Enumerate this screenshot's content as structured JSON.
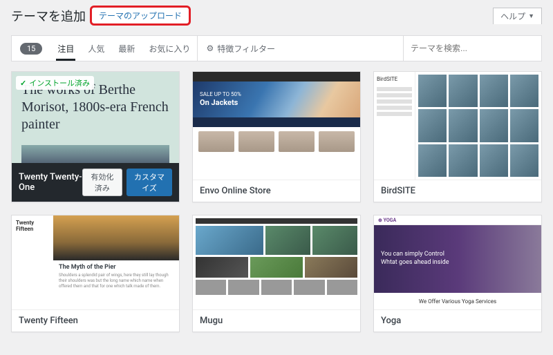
{
  "header": {
    "page_title": "テーマを追加",
    "upload_button": "テーマのアップロード",
    "help_tab": "ヘルプ"
  },
  "filter": {
    "count": "15",
    "tabs": {
      "featured": "注目",
      "popular": "人気",
      "latest": "最新",
      "favorite": "お気に入り"
    },
    "feature_filter": "特徴フィルター",
    "search_placeholder": "テーマを検索..."
  },
  "themes": {
    "twenty21": {
      "name": "Twenty Twenty-One",
      "installed_label": "インストール済み",
      "headline": "The works of Berthe Morisot, 1800s-era French painter",
      "activated_btn": "有効化済み",
      "customize_btn": "カスタマイズ"
    },
    "envo": {
      "name": "Envo Online Store",
      "hero_small": "SALE UP TO 50%",
      "hero_big": "On Jackets"
    },
    "birdsite": {
      "name": "BirdSITE",
      "logo": "BirdSITE"
    },
    "fifteen": {
      "name": "Twenty Fifteen",
      "side_title": "Twenty Fifteen",
      "article_title": "The Myth of the Pier"
    },
    "mugu": {
      "name": "Mugu"
    },
    "yoga": {
      "name": "Yoga",
      "logo": "⊕ YOGA",
      "hero1": "You can simply Control Whtat goes ahead inside",
      "strip": "We Offer Various Yoga Services"
    }
  }
}
